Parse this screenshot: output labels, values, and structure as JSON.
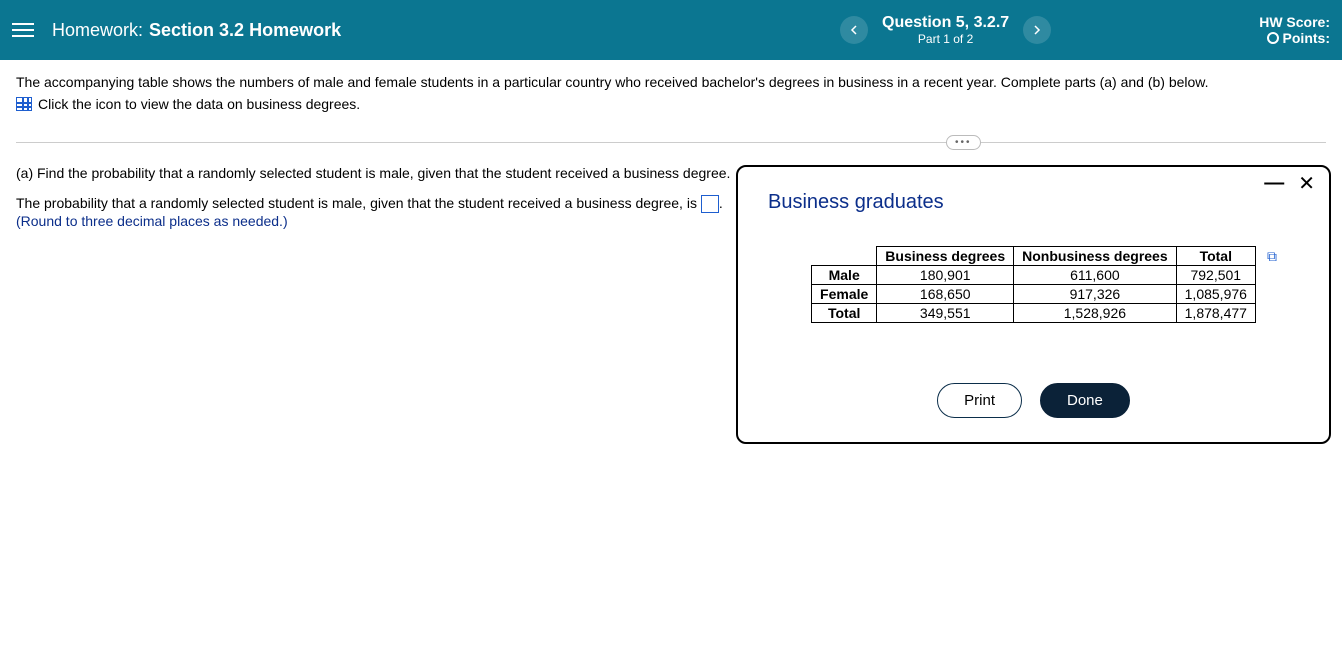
{
  "header": {
    "homework_label": "Homework:",
    "homework_title": "Section 3.2 Homework",
    "question_title": "Question 5, 3.2.7",
    "question_part": "Part 1 of 2",
    "score_label": "HW Score:",
    "points_label": "Points:"
  },
  "question": {
    "intro": "The accompanying table shows the numbers of male and female students in a particular country who received bachelor's degrees in business in a recent year. Complete parts (a) and (b) below.",
    "data_link": "Click the icon to view the data on business degrees.",
    "part_a_prompt": "(a) Find the probability that a randomly selected student is male, given that the student received a business degree.",
    "part_a_fill_pre": "The probability that a randomly selected student is male, given that the student received a business degree, is ",
    "part_a_fill_post": ".",
    "round_hint": "(Round to three decimal places as needed.)"
  },
  "popup": {
    "title": "Business graduates",
    "print_label": "Print",
    "done_label": "Done",
    "table": {
      "col_headers": [
        "",
        "Business degrees",
        "Nonbusiness degrees",
        "Total"
      ],
      "rows": [
        {
          "label": "Male",
          "cells": [
            "180,901",
            "611,600",
            "792,501"
          ]
        },
        {
          "label": "Female",
          "cells": [
            "168,650",
            "917,326",
            "1,085,976"
          ]
        },
        {
          "label": "Total",
          "cells": [
            "349,551",
            "1,528,926",
            "1,878,477"
          ]
        }
      ]
    }
  }
}
